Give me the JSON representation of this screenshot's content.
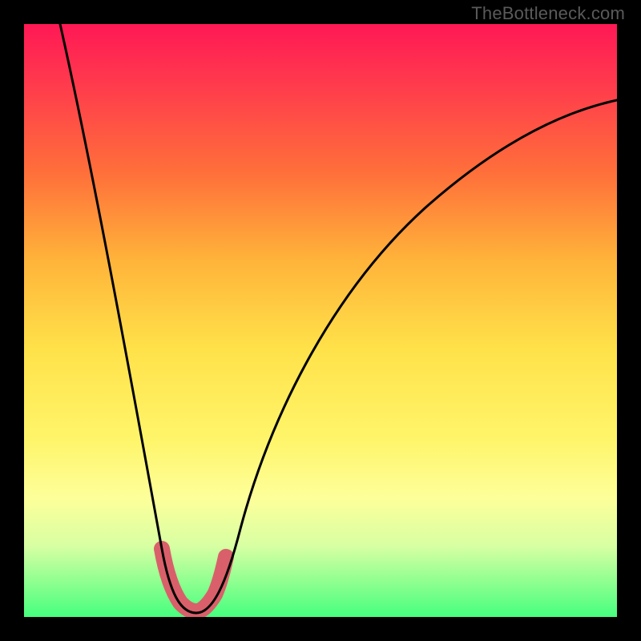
{
  "watermark": "TheBottleneck.com",
  "chart_data": {
    "type": "line",
    "title": "",
    "xlabel": "",
    "ylabel": "",
    "x_range": [
      0,
      100
    ],
    "y_range": [
      0,
      100
    ],
    "grid": false,
    "notes": "Bottleneck-style V-curve on vertical red→green gradient; no axis ticks or numeric labels are rendered in the image — values below are estimated from pixel positions.",
    "minimum_x_estimate": 27,
    "series": [
      {
        "name": "main-curve",
        "x": [
          5,
          10,
          15,
          20,
          23,
          25,
          27,
          30,
          32,
          35,
          40,
          50,
          60,
          70,
          80,
          90,
          100
        ],
        "y_est": [
          100,
          78,
          55,
          30,
          12,
          3,
          0,
          3,
          12,
          27,
          43,
          60,
          70,
          76,
          80,
          83,
          85
        ]
      }
    ],
    "highlight_region": {
      "description": "Thick coral band marking the curve bottom near the minimum",
      "approx_x_range": [
        23,
        32
      ],
      "approx_y_range": [
        0,
        12
      ]
    },
    "gradient_stops": [
      {
        "pos": 0.0,
        "color": "#ff1855"
      },
      {
        "pos": 0.1,
        "color": "#ff3a4d"
      },
      {
        "pos": 0.25,
        "color": "#ff6f3a"
      },
      {
        "pos": 0.4,
        "color": "#ffb43a"
      },
      {
        "pos": 0.55,
        "color": "#ffe24a"
      },
      {
        "pos": 0.7,
        "color": "#fff56a"
      },
      {
        "pos": 0.8,
        "color": "#fdff9a"
      },
      {
        "pos": 0.88,
        "color": "#d8ffa3"
      },
      {
        "pos": 1.0,
        "color": "#46ff7e"
      }
    ]
  }
}
